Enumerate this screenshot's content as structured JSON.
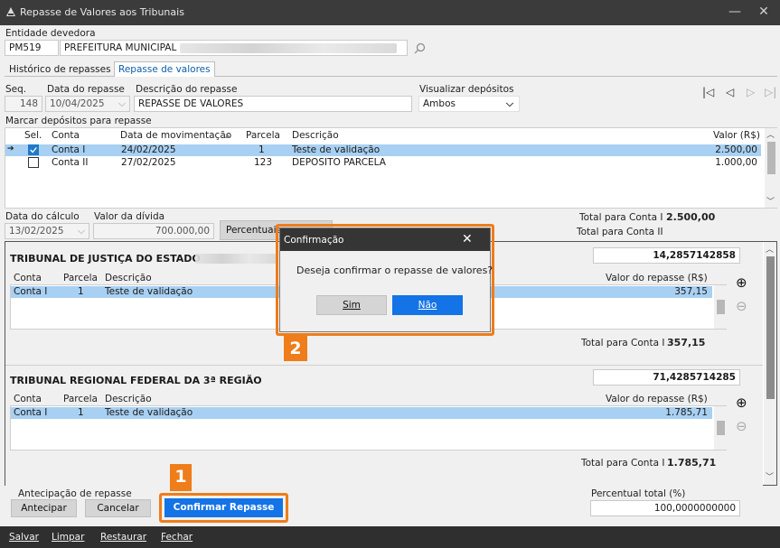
{
  "window": {
    "title": "Repasse de Valores aos Tribunais",
    "minimize": "—",
    "close": "✕"
  },
  "entidade": {
    "label": "Entidade devedora",
    "code": "PM519",
    "name": "PREFEITURA MUNICIPAL"
  },
  "tabs": [
    {
      "label": "Histórico de repasses"
    },
    {
      "label": "Repasse de valores"
    }
  ],
  "form": {
    "seq_label": "Seq.",
    "seq": "148",
    "data_label": "Data do repasse",
    "data": "10/04/2025",
    "desc_label": "Descrição do repasse",
    "desc": "REPASSE DE VALORES",
    "vis_label": "Visualizar depósitos",
    "vis": "Ambos",
    "nav": [
      "|◁",
      "◁",
      "▷",
      "▷|"
    ]
  },
  "depositos": {
    "section_label": "Marcar depósitos para repasse",
    "headers": {
      "sel": "Sel.",
      "conta": "Conta",
      "data": "Data de movimentação",
      "parcela": "Parcela",
      "descricao": "Descrição",
      "valor": "Valor (R$)"
    },
    "rows": [
      {
        "conta": "Conta I",
        "data": "24/02/2025",
        "parcela": "1",
        "descricao": "Teste de validação",
        "valor": "2.500,00",
        "checked": true,
        "selected": true
      },
      {
        "conta": "Conta II",
        "data": "27/02/2025",
        "parcela": "123",
        "descricao": "DEPOSITO PARCELA",
        "valor": "1.000,00",
        "checked": false,
        "selected": false
      }
    ]
  },
  "calculo": {
    "data_label": "Data do cálculo",
    "data": "13/02/2025",
    "divida_label": "Valor da dívida",
    "divida": "700.000,00",
    "percentuais_btn": "Percentuais",
    "total_c1_label": "Total para Conta I",
    "total_c1": "2.500,00",
    "total_c2_label": "Total para Conta II"
  },
  "tribunais": [
    {
      "name": "TRIBUNAL DE JUSTIÇA DO ESTADO",
      "percent": "14,2857142858",
      "headers": {
        "conta": "Conta",
        "parcela": "Parcela",
        "descricao": "Descrição",
        "valor": "Valor do repasse (R$)"
      },
      "row": {
        "conta": "Conta I",
        "parcela": "1",
        "descricao": "Teste de validação",
        "valor": "357,15"
      },
      "total_label": "Total para Conta I",
      "total": "357,15"
    },
    {
      "name": "TRIBUNAL REGIONAL FEDERAL DA 3ª REGIÃO",
      "percent": "71,4285714285",
      "headers": {
        "conta": "Conta",
        "parcela": "Parcela",
        "descricao": "Descrição",
        "valor": "Valor do repasse (R$)"
      },
      "row": {
        "conta": "Conta I",
        "parcela": "1",
        "descricao": "Teste de validação",
        "valor": "1.785,71"
      },
      "total_label": "Total para Conta I",
      "total": "1.785,71"
    }
  ],
  "antecipacao": {
    "label": "Antecipação de repasse",
    "antecipar": "Antecipar",
    "cancelar": "Cancelar",
    "confirmar": "Confirmar Repasse"
  },
  "percentual_total": {
    "label": "Percentual total (%)",
    "value": "100,0000000000"
  },
  "dialog": {
    "title": "Confirmação",
    "message": "Deseja confirmar o repasse de valores?",
    "sim": "Sim",
    "nao": "Não",
    "close": "✕"
  },
  "annotations": {
    "step1": "1",
    "step2": "2"
  },
  "footer": [
    "Salvar",
    "Limpar",
    "Restaurar",
    "Fechar"
  ],
  "colors": {
    "accent": "#1473e6",
    "highlight": "#ee7d1a",
    "selection": "#a8d0f2"
  }
}
